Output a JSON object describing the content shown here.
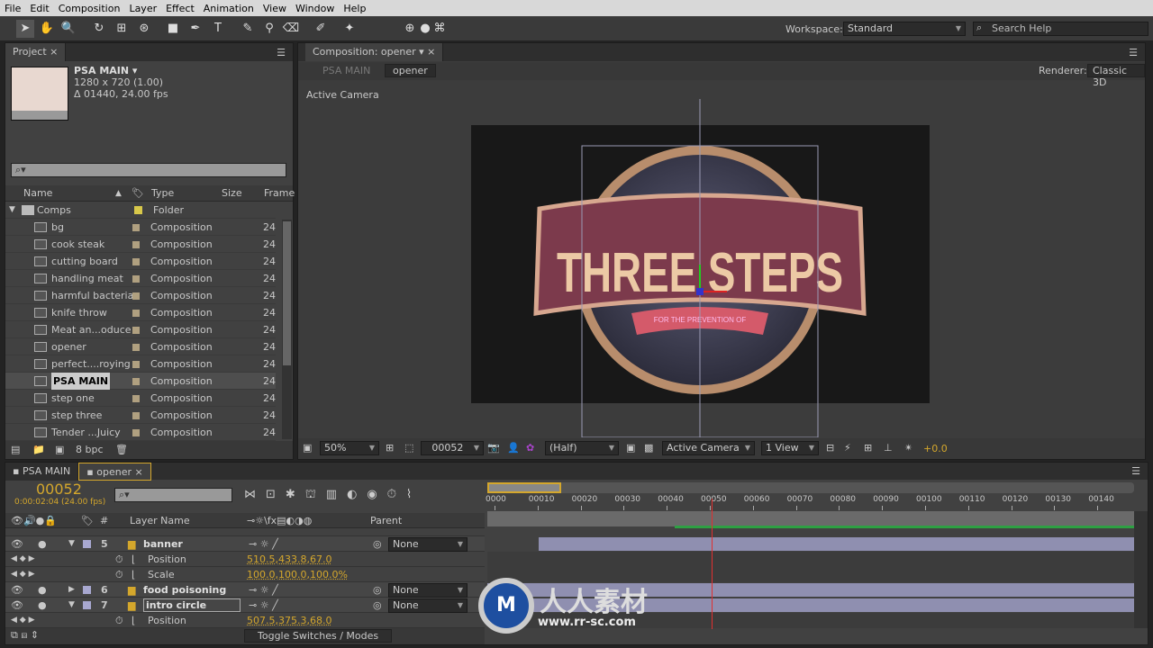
{
  "menu": [
    "File",
    "Edit",
    "Composition",
    "Layer",
    "Effect",
    "Animation",
    "View",
    "Window",
    "Help"
  ],
  "toolbar": {
    "workspace_label": "Workspace:",
    "workspace_value": "Standard",
    "search_placeholder": "Search Help"
  },
  "project": {
    "tab": "Project",
    "comp_name": "PSA MAIN ▾",
    "comp_dims": "1280 x 720 (1.00)",
    "comp_duration": "Δ 01440, 24.00 fps",
    "columns": {
      "name": "Name",
      "type": "Type",
      "size": "Size",
      "frame": "Frame"
    },
    "folder": {
      "name": "Comps",
      "type": "Folder"
    },
    "items": [
      {
        "name": "bg",
        "type": "Composition",
        "frame": "24"
      },
      {
        "name": "cook steak",
        "type": "Composition",
        "frame": "24"
      },
      {
        "name": "cutting board",
        "type": "Composition",
        "frame": "24"
      },
      {
        "name": "handling meat",
        "type": "Composition",
        "frame": "24"
      },
      {
        "name": "harmful bacteria",
        "type": "Composition",
        "frame": "24"
      },
      {
        "name": "knife throw",
        "type": "Composition",
        "frame": "24"
      },
      {
        "name": "Meat an...oduce",
        "type": "Composition",
        "frame": "24"
      },
      {
        "name": "opener",
        "type": "Composition",
        "frame": "24"
      },
      {
        "name": "perfect....roying",
        "type": "Composition",
        "frame": "24"
      },
      {
        "name": "PSA MAIN",
        "type": "Composition",
        "frame": "24",
        "selected": true
      },
      {
        "name": "step one",
        "type": "Composition",
        "frame": "24"
      },
      {
        "name": "step three",
        "type": "Composition",
        "frame": "24"
      },
      {
        "name": "Tender ...Juicy",
        "type": "Composition",
        "frame": "24"
      }
    ],
    "bpc": "8 bpc"
  },
  "composition": {
    "tab": "Composition: opener",
    "breadcrumbs": [
      "PSA MAIN",
      "opener"
    ],
    "renderer_label": "Renderer:",
    "renderer": "Classic 3D",
    "view_label": "Active Camera",
    "artwork": {
      "title": "THREE STEPS",
      "ribbon": "FOR THE PREVENTION OF"
    },
    "footer": {
      "zoom": "50%",
      "timecode": "00052",
      "resolution": "(Half)",
      "camera": "Active Camera",
      "views": "1 View",
      "exposure": "+0.0"
    }
  },
  "timeline": {
    "tabs": [
      "PSA MAIN",
      "opener"
    ],
    "current_frame": "00052",
    "current_time": "0:00:02:04 (24.00 fps)",
    "columns": {
      "num": "#",
      "layer_name": "Layer Name",
      "parent": "Parent"
    },
    "ruler": [
      "0000",
      "00010",
      "00020",
      "00030",
      "00040",
      "00050",
      "00060",
      "00070",
      "00080",
      "00090",
      "00100",
      "00110",
      "00120",
      "00130",
      "00140"
    ],
    "playhead_frame": 52,
    "layers": [
      {
        "num": "5",
        "name": "banner",
        "parent": "None",
        "props": [
          {
            "name": "Position",
            "value": "510.5,433.8,67.0"
          },
          {
            "name": "Scale",
            "value": "100.0,100.0,100.0%"
          }
        ]
      },
      {
        "num": "6",
        "name": "food poisoning",
        "parent": "None",
        "props": []
      },
      {
        "num": "7",
        "name": "intro circle",
        "parent": "None",
        "props": [
          {
            "name": "Position",
            "value": "507.5,375.3,68.0"
          }
        ]
      }
    ],
    "toggle_label": "Toggle Switches / Modes"
  },
  "watermark": {
    "text": "人人素材",
    "url": "www.rr-sc.com"
  },
  "colors": {
    "accent": "#d4a72c",
    "playhead": "#e03030",
    "work_area": "#2ea043",
    "layer_bar": "#8f8fb0"
  }
}
